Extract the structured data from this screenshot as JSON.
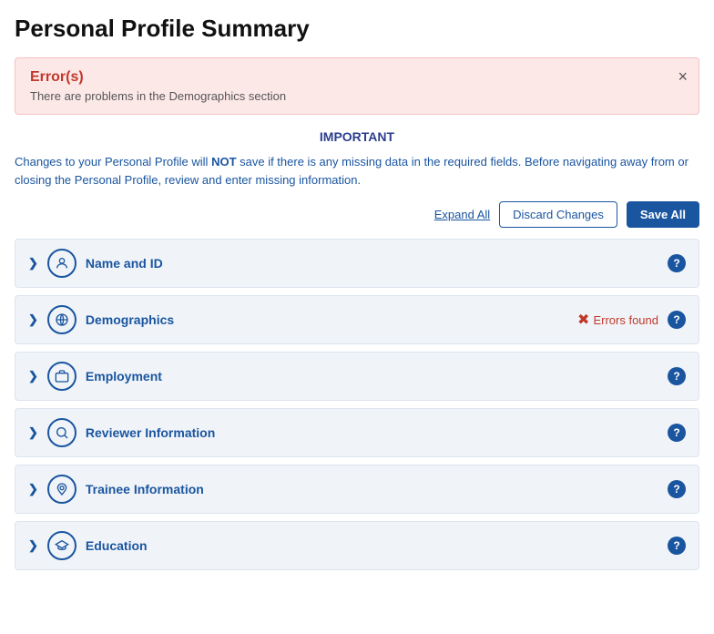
{
  "page": {
    "title": "Personal Profile Summary"
  },
  "error_banner": {
    "title": "Error(s)",
    "description": "There are problems in the Demographics section",
    "close_label": "×"
  },
  "important": {
    "label": "IMPORTANT",
    "text_part1": "Changes to your Personal Profile will ",
    "text_bold": "NOT",
    "text_part2": " save if there is any missing data in the required fields. Before navigating away from or closing the Personal Profile, review and enter missing information."
  },
  "toolbar": {
    "expand_all": "Expand All",
    "discard_changes": "Discard Changes",
    "save_all": "Save All"
  },
  "sections": [
    {
      "id": "name-id",
      "label": "Name and ID",
      "icon": "person",
      "has_error": false,
      "error_text": ""
    },
    {
      "id": "demographics",
      "label": "Demographics",
      "icon": "globe",
      "has_error": true,
      "error_text": "Errors found"
    },
    {
      "id": "employment",
      "label": "Employment",
      "icon": "briefcase",
      "has_error": false,
      "error_text": ""
    },
    {
      "id": "reviewer-information",
      "label": "Reviewer Information",
      "icon": "search",
      "has_error": false,
      "error_text": ""
    },
    {
      "id": "trainee-information",
      "label": "Trainee Information",
      "icon": "pin",
      "has_error": false,
      "error_text": ""
    },
    {
      "id": "education",
      "label": "Education",
      "icon": "graduation",
      "has_error": false,
      "error_text": ""
    }
  ],
  "icons": {
    "person": "👤",
    "globe": "🌐",
    "briefcase": "💼",
    "search": "🔍",
    "pin": "📍",
    "graduation": "🎓"
  }
}
